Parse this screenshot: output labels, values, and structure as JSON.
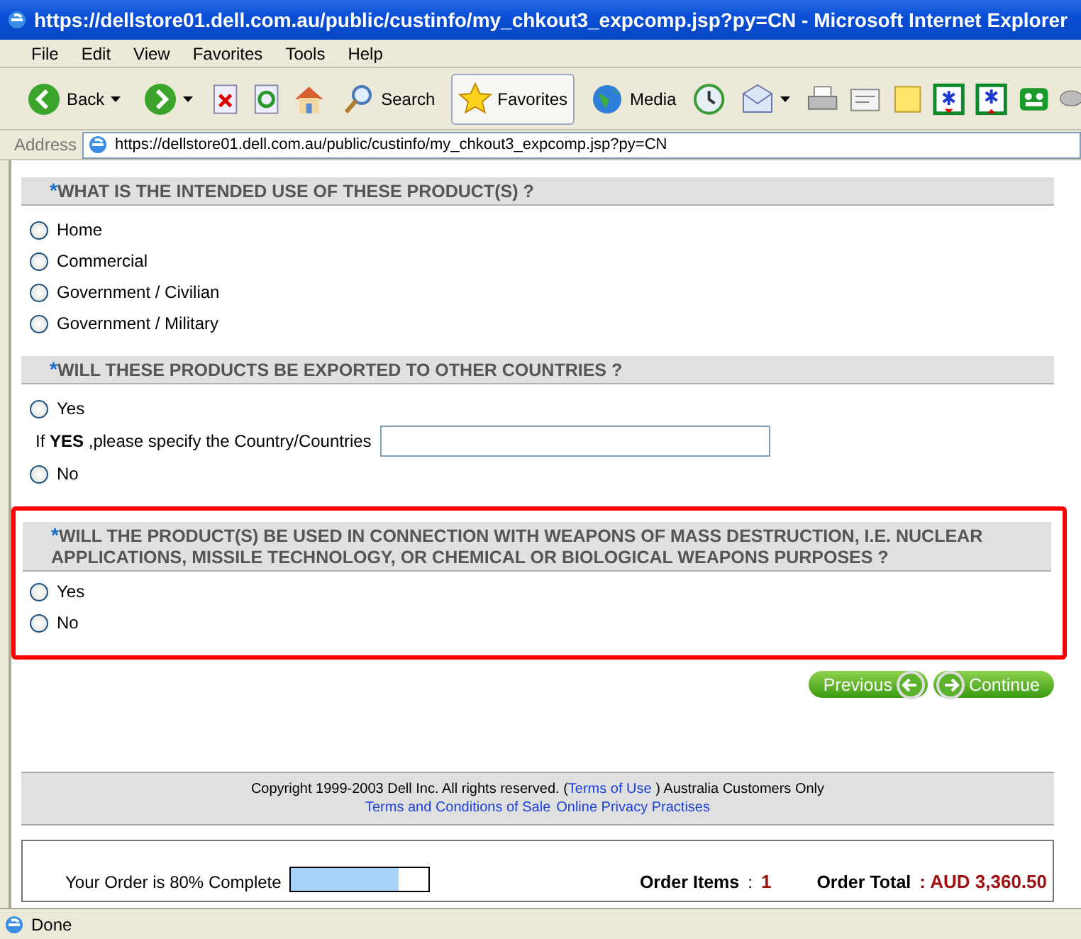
{
  "window": {
    "title": "https://dellstore01.dell.com.au/public/custinfo/my_chkout3_expcomp.jsp?py=CN - Microsoft Internet Explorer"
  },
  "menu": [
    "File",
    "Edit",
    "View",
    "Favorites",
    "Tools",
    "Help"
  ],
  "toolbar": {
    "back": {
      "label": "Back"
    },
    "search": {
      "label": "Search"
    },
    "favorites": {
      "label": "Favorites",
      "selected": true
    },
    "media": {
      "label": "Media"
    }
  },
  "address": {
    "label": "Address",
    "value": "https://dellstore01.dell.com.au/public/custinfo/my_chkout3_expcomp.jsp?py=CN"
  },
  "questions": [
    {
      "marker": "*",
      "text": "WHAT IS THE INTENDED USE OF THESE PRODUCT(S) ?",
      "highlighted": false,
      "options": [
        {
          "label": "Home",
          "selected": false
        },
        {
          "label": "Commercial",
          "selected": false
        },
        {
          "label": "Government / Civilian",
          "selected": false
        },
        {
          "label": "Government / Military",
          "selected": false
        }
      ]
    },
    {
      "marker": "*",
      "text": "WILL THESE PRODUCTS BE EXPORTED TO OTHER COUNTRIES ?",
      "highlighted": false,
      "options": [
        {
          "label": "Yes",
          "selected": false
        },
        {
          "label": "No",
          "selected": false
        }
      ],
      "country_prompt": "If **YES** ,please specify the Country/Countries"
    },
    {
      "marker": "*",
      "text": "WILL THE PRODUCT(S) BE USED IN CONNECTION WITH WEAPONS OF MASS DESTRUCTION, I.E. NUCLEAR APPLICATIONS, MISSILE TECHNOLOGY, OR CHEMICAL OR BIOLOGICAL WEAPONS PURPOSES ?",
      "highlighted": true,
      "options": [
        {
          "label": "Yes",
          "selected": false
        },
        {
          "label": "No",
          "selected": false
        }
      ]
    }
  ],
  "buttons": {
    "previous": "Previous",
    "continue": "Continue"
  },
  "footer": {
    "copyright_before": "Copyright 1999-2003 Dell Inc. All rights reserved. (",
    "terms_of_use": "Terms of Use",
    "copyright_after": " ) Australia Customers Only",
    "terms_of_sale": "Terms and Conditions of Sale",
    "privacy": "Online Privacy Practises"
  },
  "order": {
    "progress_label": "Your Order is 80% Complete",
    "level": 0.78,
    "items_label": "Order Items",
    "items_sep": ":",
    "items_value": "1",
    "total_label": "Order Total",
    "total_value": ": AUD 3,360.50"
  },
  "status_bar": {
    "text": "Done"
  }
}
